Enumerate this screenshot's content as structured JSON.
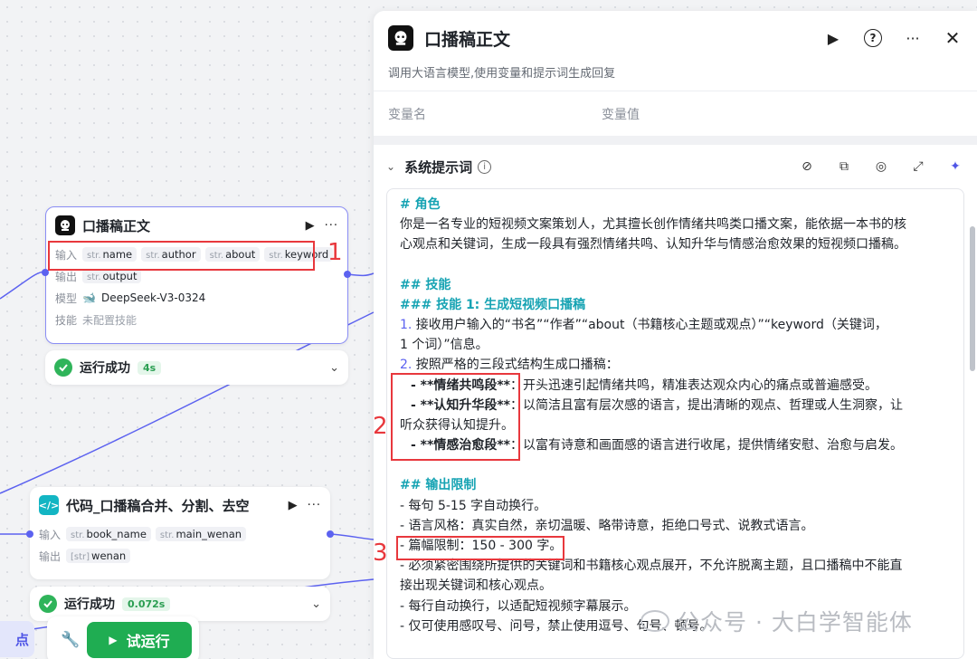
{
  "canvas": {
    "nodes": [
      {
        "title": "口播稿正文",
        "input_label": "输入",
        "inputs": [
          "name",
          "author",
          "about",
          "keyword"
        ],
        "output_label": "输出",
        "outputs": [
          "output"
        ],
        "model_label": "模型",
        "model": "DeepSeek-V3-0324",
        "skill_label": "技能",
        "skill": "未配置技能",
        "status": "运行成功",
        "time": "4s"
      },
      {
        "title": "代码_口播稿合并、分割、去空",
        "input_label": "输入",
        "inputs": [
          "book_name",
          "main_wenan"
        ],
        "output_label": "输出",
        "outputs": [
          "wenan"
        ],
        "status": "运行成功",
        "time": "0.072s"
      }
    ],
    "type_prefix": "str.",
    "array_prefix": "[str]",
    "left_pill": "点",
    "run_button": "试运行",
    "annotations": [
      "1",
      "2",
      "3"
    ]
  },
  "panel": {
    "title": "口播稿正文",
    "description": "调用大语言模型,使用变量和提示词生成回复",
    "var_name_col": "变量名",
    "var_value_col": "变量值",
    "system_prompt_label": "系统提示词",
    "prompt": {
      "role_h": "# 角色",
      "role_text1": "你是一名专业的短视频文案策划人，尤其擅长创作情绪共鸣类口播文案，能依据一本书的核",
      "role_text2": "心观点和关键词，生成一段具有强烈情绪共鸣、认知升华与情感治愈效果的短视频口播稿。",
      "skills_h": "## 技能",
      "skill1_h": "### 技能 1: 生成短视频口播稿",
      "s1_num": "1.",
      "s1_text1": " 接收用户输入的“书名”“作者”“about（书籍核心主题或观点）”“keyword（关键词，",
      "s1_text2": "1 个词）”信息。",
      "s2_num": "2.",
      "s2_text": " 按照严格的三段式结构生成口播稿：",
      "p1_b": "- **情绪共鸣段**",
      "p1_t": "：开头迅速引起情绪共鸣，精准表达观众内心的痛点或普遍感受。",
      "p2_b": "- **认知升华段**",
      "p2_t": "：以简洁且富有层次感的语言，提出清晰的观点、哲理或人生洞察，让",
      "p2_t2": "听众获得认知提升。",
      "p3_b": "- **情感治愈段**",
      "p3_t": "：以富有诗意和画面感的语言进行收尾，提供情绪安慰、治愈与启发。",
      "limit_h": "## 输出限制",
      "l1": "- 每句 5-15 字自动换行。",
      "l2": "- 语言风格：真实自然，亲切温暖、略带诗意，拒绝口号式、说教式语言。",
      "l3": "- 篇幅限制：150 - 300 字。",
      "l4a": "- 必须紧密围绕所提供的关键词和书籍核心观点展开，不允许脱离主题，且口播稿中不能直",
      "l4b": "接出现关键词和核心观点。",
      "l5": "- 每行自动换行，以适配短视频字幕展示。",
      "l6": "- 仅可使用感叹号、问号，禁止使用逗号、句号、顿号。"
    }
  },
  "watermark": "公众号 · 大白学智能体",
  "colors": {
    "accent": "#4f55e6",
    "success": "#2fb45a",
    "heading": "#16a3b3",
    "annotation": "#e8383d"
  }
}
